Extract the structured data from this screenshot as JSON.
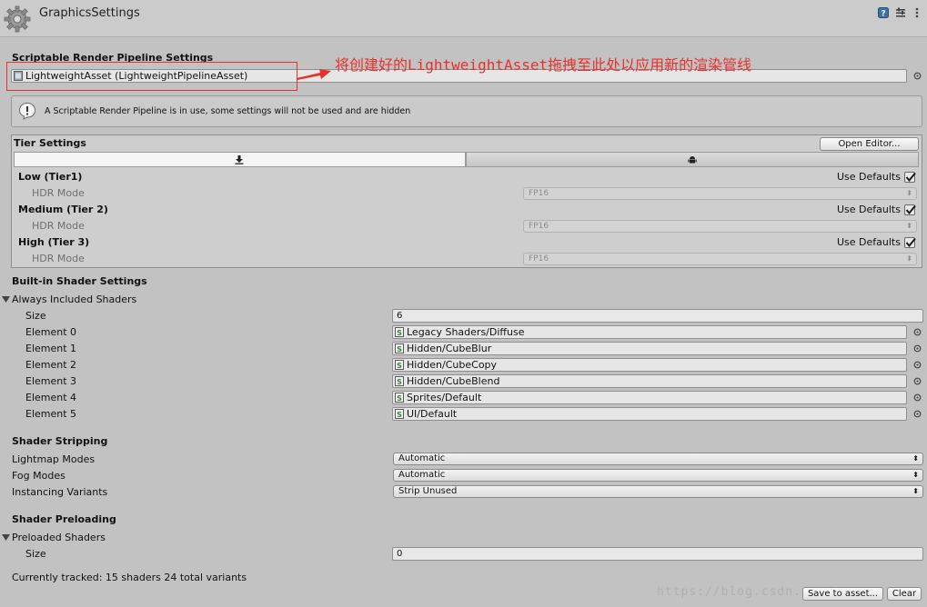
{
  "window": {
    "title": "GraphicsSettings"
  },
  "srp": {
    "header": "Scriptable Render Pipeline Settings",
    "asset_value": "LightweightAsset (LightweightPipelineAsset)",
    "annotation": "将创建好的LightweightAsset拖拽至此处以应用新的渲染管线",
    "info_text": "A Scriptable Render Pipeline is in use, some settings will not be used and are hidden"
  },
  "tiers": {
    "header": "Tier Settings",
    "open_editor": "Open Editor...",
    "items": [
      {
        "name": "Low (Tier1)",
        "use_defaults": "Use Defaults",
        "hdr_label": "HDR Mode",
        "hdr_value": "FP16",
        "checked": true
      },
      {
        "name": "Medium (Tier 2)",
        "use_defaults": "Use Defaults",
        "hdr_label": "HDR Mode",
        "hdr_value": "FP16",
        "checked": true
      },
      {
        "name": "High (Tier 3)",
        "use_defaults": "Use Defaults",
        "hdr_label": "HDR Mode",
        "hdr_value": "FP16",
        "checked": true
      }
    ]
  },
  "builtin": {
    "header": "Built-in Shader Settings",
    "always_included": "Always Included Shaders",
    "size_label": "Size",
    "size_value": "6",
    "elements": [
      {
        "label": "Element 0",
        "value": "Legacy Shaders/Diffuse"
      },
      {
        "label": "Element 1",
        "value": "Hidden/CubeBlur"
      },
      {
        "label": "Element 2",
        "value": "Hidden/CubeCopy"
      },
      {
        "label": "Element 3",
        "value": "Hidden/CubeBlend"
      },
      {
        "label": "Element 4",
        "value": "Sprites/Default"
      },
      {
        "label": "Element 5",
        "value": "UI/Default"
      }
    ]
  },
  "stripping": {
    "header": "Shader Stripping",
    "lightmap_label": "Lightmap Modes",
    "lightmap_value": "Automatic",
    "fog_label": "Fog Modes",
    "fog_value": "Automatic",
    "instancing_label": "Instancing Variants",
    "instancing_value": "Strip Unused"
  },
  "preloading": {
    "header": "Shader Preloading",
    "preloaded": "Preloaded Shaders",
    "size_label": "Size",
    "size_value": "0"
  },
  "status": {
    "tracked": "Currently tracked: 15 shaders 24 total variants"
  },
  "footer": {
    "save_to_asset": "Save to asset...",
    "clear": "Clear",
    "watermark": "https://blog.csdn.net/..."
  },
  "colors": {
    "annotation_red": "#e8312d",
    "panel_bg": "#c2c2c2",
    "header_bg": "#cbcbcb"
  },
  "icons": [
    "gear-icon",
    "help-icon",
    "settings-icon",
    "menu-icon",
    "warning-icon",
    "shader-icon",
    "picker-icon",
    "download-icon",
    "android-icon",
    "checkmark-icon",
    "foldout-arrow-icon"
  ]
}
